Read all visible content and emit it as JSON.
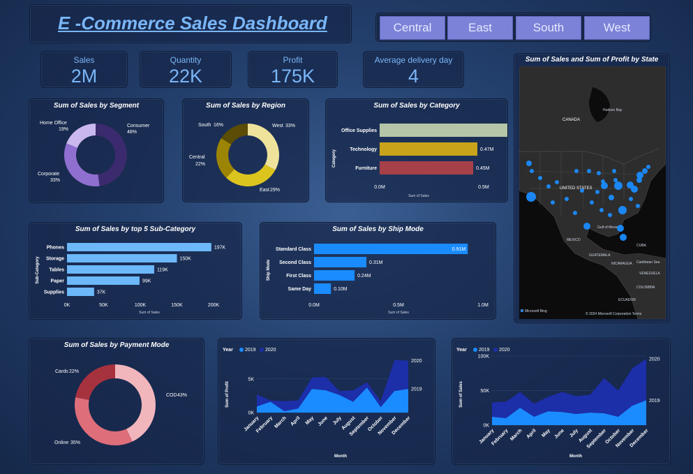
{
  "header": {
    "title": "E -Commerce Sales Dashboard",
    "regions": [
      "Central",
      "East",
      "South",
      "West"
    ]
  },
  "kpis": [
    {
      "label": "Sales",
      "value": "2M"
    },
    {
      "label": "Quantity",
      "value": "22K"
    },
    {
      "label": "Profit",
      "value": "175K"
    },
    {
      "label": "Average delivery day",
      "value": "4"
    }
  ],
  "colors": {
    "accent": "#7ab6f8",
    "slicer": "#7b82d7",
    "bar_blue": "#6cb8f9",
    "bar_bright": "#1a8cff",
    "series_2019": "#1a8cff",
    "series_2020": "#1c2ea8"
  },
  "map": {
    "title": "Sum of Sales and Sum of Profit by State",
    "labels": [
      "Hudson Bay",
      "CANADA",
      "UNITED STATES",
      "Gulf of Mexico",
      "MEXICO",
      "GUATEMALA",
      "NICARAGUA",
      "CUBA",
      "Caribbean Sea",
      "VENEZUELA",
      "COLOMBIA",
      "ECUADOR"
    ],
    "attribution": "Microsoft Bing",
    "copyright": "© 2024 Microsoft Corporation Terms"
  },
  "chart_data": [
    {
      "id": "segment",
      "type": "pie",
      "donut": true,
      "title": "Sum of Sales by Segment",
      "labels": [
        "Consumer",
        "Corporate",
        "Home Office"
      ],
      "values": [
        48,
        33,
        19
      ],
      "value_labels": [
        "48%",
        "33%",
        "19%"
      ],
      "colors": [
        "#3b2a6e",
        "#8f6fd0",
        "#c9b8ee"
      ]
    },
    {
      "id": "region",
      "type": "pie",
      "donut": true,
      "title": "Sum of Sales by Region",
      "labels": [
        "West",
        "East",
        "Central",
        "South"
      ],
      "values": [
        33,
        29,
        22,
        16
      ],
      "value_labels": [
        "33%",
        "29%",
        "22%",
        "16%"
      ],
      "colors": [
        "#efe39c",
        "#dcc41e",
        "#9c8405",
        "#5b4c06"
      ]
    },
    {
      "id": "category",
      "type": "bar",
      "orientation": "horizontal",
      "title": "Sum of Sales by Category",
      "categories": [
        "Office Supplies",
        "Technology",
        "Furniture"
      ],
      "values": [
        0.64,
        0.47,
        0.45
      ],
      "value_labels": [
        "0.64M",
        "0.47M",
        "0.45M"
      ],
      "colors": [
        "#b5c6a8",
        "#c9a31a",
        "#a64049"
      ],
      "xlabel": "Sum of Sales",
      "ylabel": "Category",
      "ticks": [
        "0.0M",
        "0.5M"
      ],
      "xlim": [
        0,
        0.75
      ]
    },
    {
      "id": "subcategory",
      "type": "bar",
      "orientation": "horizontal",
      "title": "Sum of Sales by top 5 Sub-Category",
      "categories": [
        "Phones",
        "Storage",
        "Tables",
        "Paper",
        "Supplies"
      ],
      "values": [
        197,
        150,
        119,
        99,
        37
      ],
      "value_labels": [
        "197K",
        "150K",
        "119K",
        "99K",
        "37K"
      ],
      "xlabel": "Sum of Sales",
      "ylabel": "Sub-Category",
      "ticks": [
        "0K",
        "50K",
        "100K",
        "150K",
        "200K"
      ],
      "xlim": [
        0,
        200
      ]
    },
    {
      "id": "shipmode",
      "type": "bar",
      "orientation": "horizontal",
      "title": "Sum of Sales by Ship Mode",
      "categories": [
        "Standard Class",
        "Second Class",
        "First Class",
        "Same Day"
      ],
      "values": [
        0.91,
        0.31,
        0.24,
        0.1
      ],
      "value_labels": [
        "0.91M",
        "0.31M",
        "0.24M",
        "0.10M"
      ],
      "xlabel": "Sum of Sales",
      "ylabel": "Ship Mode",
      "ticks": [
        "0.0M",
        "0.5M",
        "1.0M"
      ],
      "xlim": [
        0,
        1.0
      ]
    },
    {
      "id": "payment",
      "type": "pie",
      "donut": true,
      "title": "Sum of Sales by Payment Mode",
      "labels": [
        "COD",
        "Online",
        "Cards"
      ],
      "values": [
        43,
        35,
        22
      ],
      "value_labels": [
        "43%",
        "35%",
        "22%"
      ],
      "colors": [
        "#f1b6bc",
        "#de6e7a",
        "#a6323e"
      ]
    },
    {
      "id": "profit_month",
      "type": "area",
      "xlabel": "Month",
      "ylabel": "Sum of Profit",
      "legend_title": "Year",
      "categories": [
        "January",
        "February",
        "March",
        "April",
        "May",
        "June",
        "July",
        "August",
        "September",
        "October",
        "November",
        "December"
      ],
      "series": [
        {
          "name": "2019",
          "values": [
            900,
            1600,
            200,
            600,
            3500,
            3300,
            2600,
            1600,
            3700,
            800,
            3200,
            3500
          ]
        },
        {
          "name": "2020",
          "values": [
            2700,
            1800,
            1700,
            1800,
            5200,
            5300,
            3200,
            3300,
            4500,
            1700,
            7800,
            7700
          ]
        }
      ],
      "ticks": [
        "0K",
        "5K"
      ],
      "ylim": [
        0,
        8500
      ]
    },
    {
      "id": "sales_month",
      "type": "area",
      "xlabel": "Month",
      "ylabel": "Sum of Sales",
      "legend_title": "Year",
      "categories": [
        "January",
        "February",
        "March",
        "April",
        "May",
        "June",
        "July",
        "August",
        "September",
        "October",
        "November",
        "December"
      ],
      "series": [
        {
          "name": "2019",
          "values": [
            12000,
            10000,
            25000,
            12000,
            20000,
            19000,
            16000,
            18000,
            17000,
            12000,
            28000,
            36000
          ]
        },
        {
          "name": "2020",
          "values": [
            33000,
            34000,
            48000,
            31000,
            41000,
            48000,
            42000,
            44000,
            68000,
            50000,
            82000,
            96000
          ]
        }
      ],
      "ticks": [
        "0K",
        "50K",
        "100K"
      ],
      "ylim": [
        0,
        100000
      ]
    }
  ]
}
